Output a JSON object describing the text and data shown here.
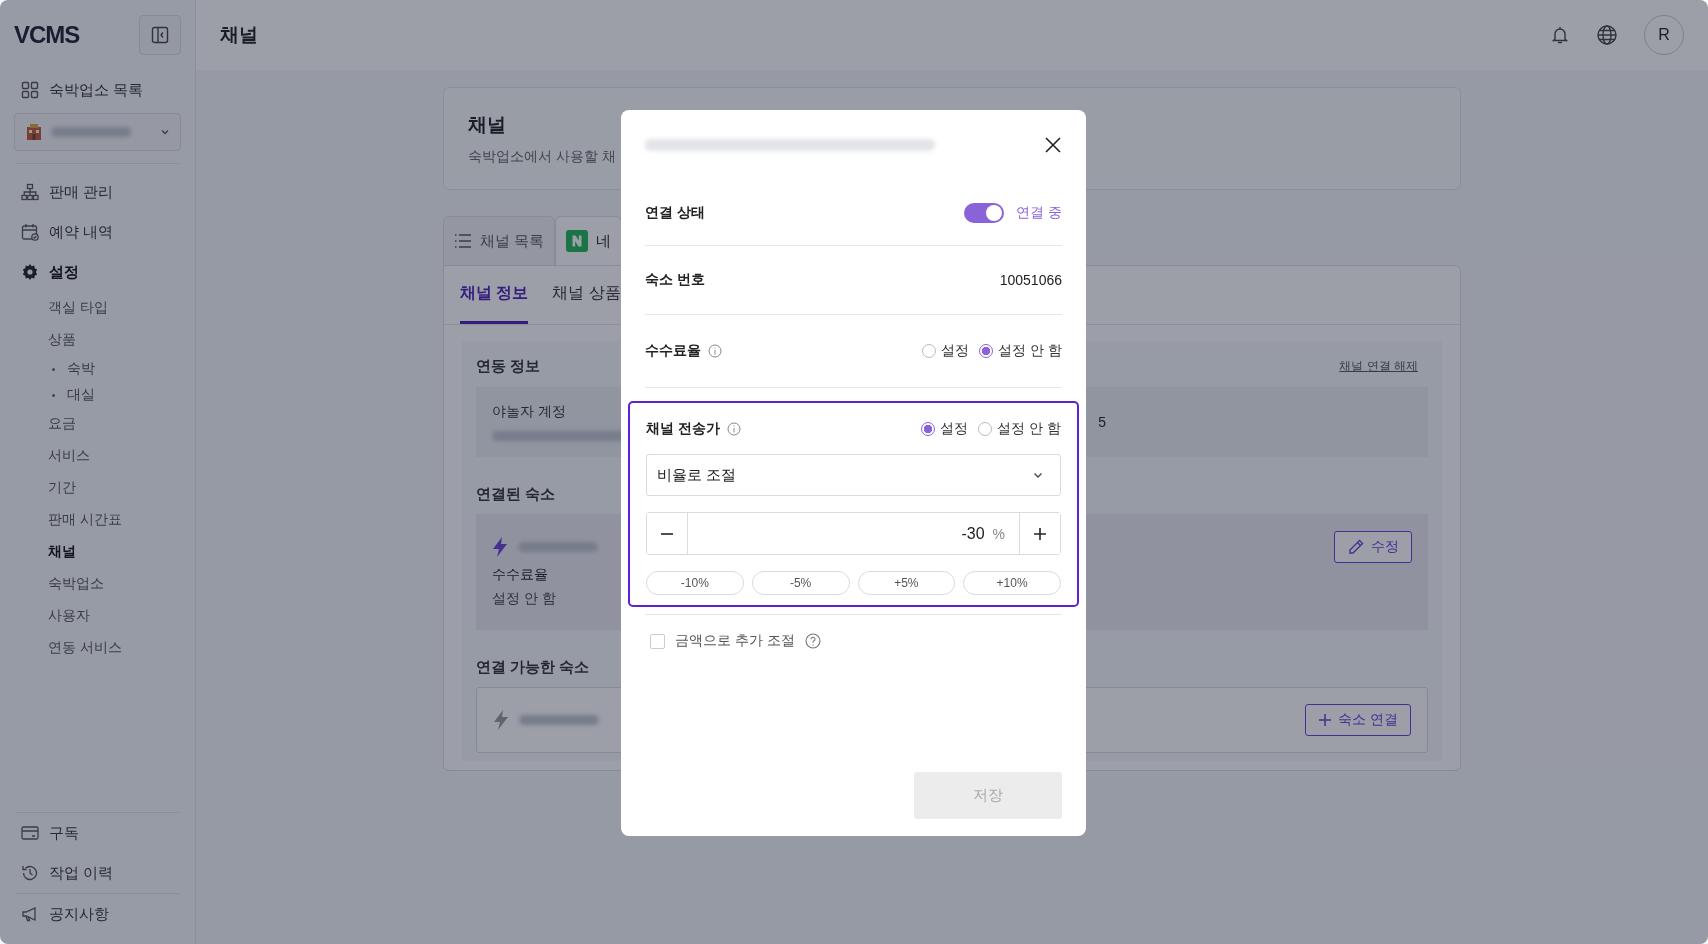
{
  "header": {
    "title": "채널",
    "avatar": "R"
  },
  "sidebar": {
    "logo": "VCMS",
    "property_list": "숙박업소 목록",
    "nav": [
      {
        "kind": "sales",
        "label": "판매 관리",
        "selected": false
      },
      {
        "kind": "reservations",
        "label": "예약 내역",
        "selected": false
      },
      {
        "kind": "settings",
        "label": "설정",
        "selected": true,
        "children": [
          {
            "label": "객실 타입",
            "selected": false
          },
          {
            "label": "상품",
            "selected": false,
            "children": [
              {
                "label": "숙박",
                "selected": false
              },
              {
                "label": "대실",
                "selected": false
              }
            ]
          },
          {
            "label": "요금",
            "selected": false
          },
          {
            "label": "서비스",
            "selected": false
          },
          {
            "label": "기간",
            "selected": false
          },
          {
            "label": "판매 시간표",
            "selected": false
          },
          {
            "label": "채널",
            "selected": true
          },
          {
            "label": "숙박업소",
            "selected": false
          },
          {
            "label": "사용자",
            "selected": false
          },
          {
            "label": "연동 서비스",
            "selected": false
          }
        ]
      }
    ],
    "footer_groups": [
      {
        "items": [
          {
            "kind": "subscription",
            "label": "구독"
          },
          {
            "kind": "history",
            "label": "작업 이력"
          }
        ]
      },
      {
        "items": [
          {
            "kind": "notice",
            "label": "공지사항"
          }
        ]
      }
    ]
  },
  "page": {
    "title": "채널",
    "description": "숙박업소에서 사용할 채",
    "channel_tabs": [
      {
        "kind": "list",
        "label": "채널 목록",
        "selected": false
      },
      {
        "kind": "naver",
        "label": "네",
        "selected": true
      }
    ],
    "sub_tabs": [
      {
        "label": "채널 정보",
        "selected": true
      },
      {
        "label": "채널 상품",
        "selected": false
      }
    ],
    "disconnect_link": "채널 연결 해제",
    "integration": {
      "title": "연동 정보",
      "account_label": "야놀자 계정",
      "value_tail": "5"
    },
    "linked": {
      "title": "연결된 숙소",
      "fee_label": "수수료율",
      "fee_value": "설정 안 함",
      "edit_button": "수정"
    },
    "available": {
      "title": "연결 가능한 숙소",
      "connect_button": "숙소 연결"
    }
  },
  "modal": {
    "rows": [
      {
        "kind": "toggle",
        "label": "연결 상태",
        "on": true,
        "status": "연결 중"
      },
      {
        "kind": "value",
        "label": "숙소 번호",
        "value": "10051066"
      },
      {
        "kind": "radio",
        "label": "수수료율",
        "options": [
          {
            "label": "설정",
            "selected": false
          },
          {
            "label": "설정 안 함",
            "selected": true
          }
        ]
      }
    ],
    "price": {
      "label": "채널 전송가",
      "highlighted": true,
      "options": [
        {
          "label": "설정",
          "selected": true
        },
        {
          "label": "설정 안 함",
          "selected": false
        }
      ],
      "mode": "비율로 조절",
      "value": "-30",
      "unit": "%",
      "presets": [
        "-10%",
        "-5%",
        "+5%",
        "+10%"
      ]
    },
    "extra": {
      "label": "금액으로 추가 조절",
      "checked": false
    },
    "save": {
      "label": "저장",
      "disabled": true
    }
  }
}
